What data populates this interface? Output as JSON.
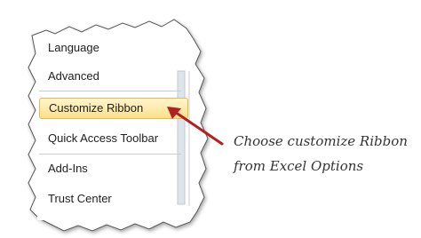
{
  "options_nav": {
    "items": [
      {
        "label": "Language",
        "selected": false
      },
      {
        "label": "Advanced",
        "selected": false
      },
      {
        "label": "Customize Ribbon",
        "selected": true
      },
      {
        "label": "Quick Access Toolbar",
        "selected": false
      },
      {
        "label": "Add-Ins",
        "selected": false
      },
      {
        "label": "Trust Center",
        "selected": false
      }
    ]
  },
  "annotation": {
    "line1": "Choose customize Ribbon",
    "line2": "from Excel Options",
    "arrow_color": "#b32020"
  },
  "colors": {
    "selection_fill": "#fde08a",
    "selection_border": "#e8b84a",
    "scrollbar_gutter": "#dfe4ea"
  }
}
